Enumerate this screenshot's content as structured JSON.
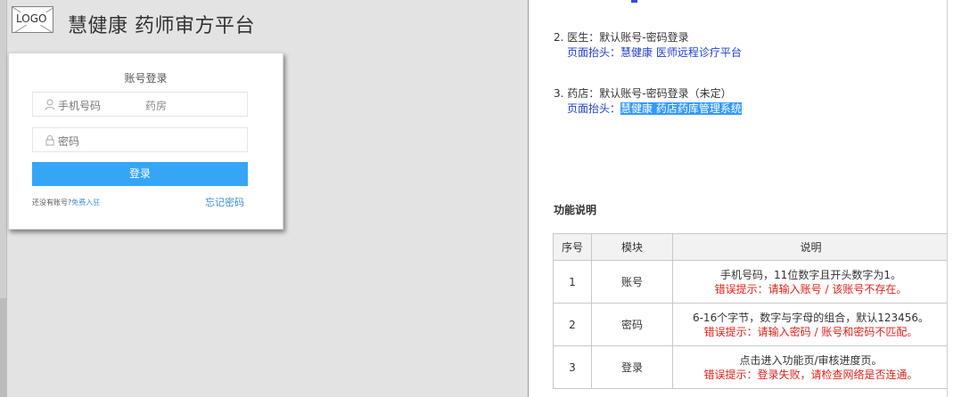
{
  "left": {
    "logo_text": "LOGO",
    "app_title": "慧健康  药师审方平台",
    "login": {
      "title": "账号登录",
      "phone_placeholder": "手机号码",
      "phone_extra": "药房",
      "password_placeholder": "密码",
      "login_button": "登录",
      "register_prompt": "还没有账号?",
      "register_link": "免费入驻",
      "forgot_link": "忘记密码"
    }
  },
  "right": {
    "notes": [
      {
        "line": "2. 医生：默认账号-密码登录",
        "header_label": "页面抬头：",
        "header_value": "慧健康 医师远程诊疗平台",
        "highlighted": false
      },
      {
        "line": "3. 药店：默认账号-密码登录（未定）",
        "header_label": "页面抬头：",
        "header_value": "慧健康 药店药库管理系统",
        "highlighted": true
      }
    ],
    "section_title": "功能说明",
    "table": {
      "headers": [
        "序号",
        "模块",
        "说明"
      ],
      "rows": [
        {
          "no": "1",
          "module": "账号",
          "desc": "手机号码，11位数字且开头数字为1。",
          "error": "错误提示：请输入账号 / 该账号不存在。"
        },
        {
          "no": "2",
          "module": "密码",
          "desc": "6-16个字节，数字与字母的组合，默认123456。",
          "error": "错误提示：请输入密码 / 账号和密码不匹配。"
        },
        {
          "no": "3",
          "module": "登录",
          "desc": "点击进入功能页/审核进度页。",
          "error": "错误提示：登录失败，请检查网络是否连通。"
        }
      ]
    }
  },
  "colors": {
    "accent": "#35a6f5",
    "link": "#3a8fd8",
    "note_blue": "#1f3fd0",
    "error_red": "#e0211a",
    "highlight": "#3399ff"
  }
}
